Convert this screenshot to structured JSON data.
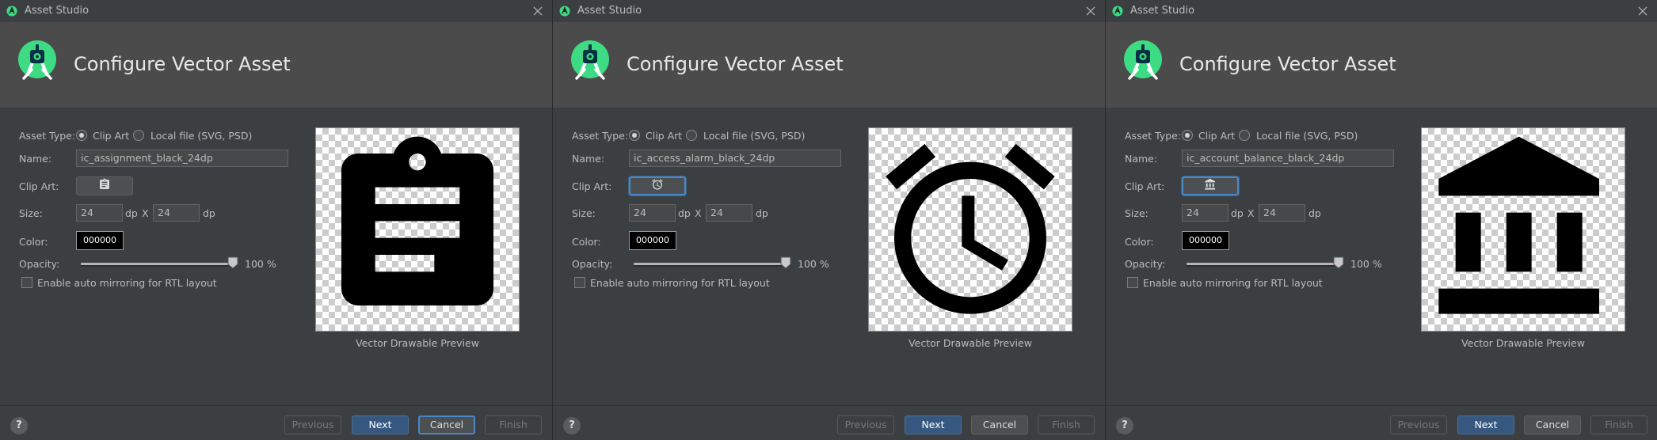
{
  "windows": [
    {
      "window_title": "Asset Studio",
      "header_title": "Configure Vector Asset",
      "asset_type_label": "Asset Type:",
      "asset_type_options": [
        "Clip Art",
        "Local file (SVG, PSD)"
      ],
      "asset_type_selected": "Clip Art",
      "name_label": "Name:",
      "name_value": "ic_assignment_black_24dp",
      "clip_art_label": "Clip Art:",
      "clip_art_icon": "assignment-icon",
      "size_label": "Size:",
      "width_value": "24",
      "height_value": "24",
      "unit": "dp",
      "size_separator": "X",
      "color_label": "Color:",
      "color_value": "000000",
      "opacity_label": "Opacity:",
      "opacity_text": "100 %",
      "opacity_percent": 100,
      "rtl_label": "Enable auto mirroring for RTL layout",
      "rtl_checked": false,
      "preview_icon": "assignment-icon",
      "preview_caption": "Vector Drawable Preview",
      "buttons": {
        "help": "?",
        "previous": "Previous",
        "next": "Next",
        "cancel": "Cancel",
        "finish": "Finish"
      },
      "clip_art_focused": false,
      "cancel_focused": true
    },
    {
      "window_title": "Asset Studio",
      "header_title": "Configure Vector Asset",
      "asset_type_label": "Asset Type:",
      "asset_type_options": [
        "Clip Art",
        "Local file (SVG, PSD)"
      ],
      "asset_type_selected": "Clip Art",
      "name_label": "Name:",
      "name_value": "ic_access_alarm_black_24dp",
      "clip_art_label": "Clip Art:",
      "clip_art_icon": "alarm-icon",
      "size_label": "Size:",
      "width_value": "24",
      "height_value": "24",
      "unit": "dp",
      "size_separator": "X",
      "color_label": "Color:",
      "color_value": "000000",
      "opacity_label": "Opacity:",
      "opacity_text": "100 %",
      "opacity_percent": 100,
      "rtl_label": "Enable auto mirroring for RTL layout",
      "rtl_checked": false,
      "preview_icon": "alarm-icon",
      "preview_caption": "Vector Drawable Preview",
      "buttons": {
        "help": "?",
        "previous": "Previous",
        "next": "Next",
        "cancel": "Cancel",
        "finish": "Finish"
      },
      "clip_art_focused": true,
      "cancel_focused": false
    },
    {
      "window_title": "Asset Studio",
      "header_title": "Configure Vector Asset",
      "asset_type_label": "Asset Type:",
      "asset_type_options": [
        "Clip Art",
        "Local file (SVG, PSD)"
      ],
      "asset_type_selected": "Clip Art",
      "name_label": "Name:",
      "name_value": "ic_account_balance_black_24dp",
      "clip_art_label": "Clip Art:",
      "clip_art_icon": "account-balance-icon",
      "size_label": "Size:",
      "width_value": "24",
      "height_value": "24",
      "unit": "dp",
      "size_separator": "X",
      "color_label": "Color:",
      "color_value": "000000",
      "opacity_label": "Opacity:",
      "opacity_text": "100 %",
      "opacity_percent": 100,
      "rtl_label": "Enable auto mirroring for RTL layout",
      "rtl_checked": false,
      "preview_icon": "account-balance-icon",
      "preview_caption": "Vector Drawable Preview",
      "buttons": {
        "help": "?",
        "previous": "Previous",
        "next": "Next",
        "cancel": "Cancel",
        "finish": "Finish"
      },
      "clip_art_focused": true,
      "cancel_focused": false
    }
  ],
  "colors": {
    "window_bg": "#3c3f41",
    "header_bg": "#4b4b4b",
    "primary_button": "#365880",
    "focus_ring": "#4a88c7",
    "android_green": "#3ddc84"
  }
}
